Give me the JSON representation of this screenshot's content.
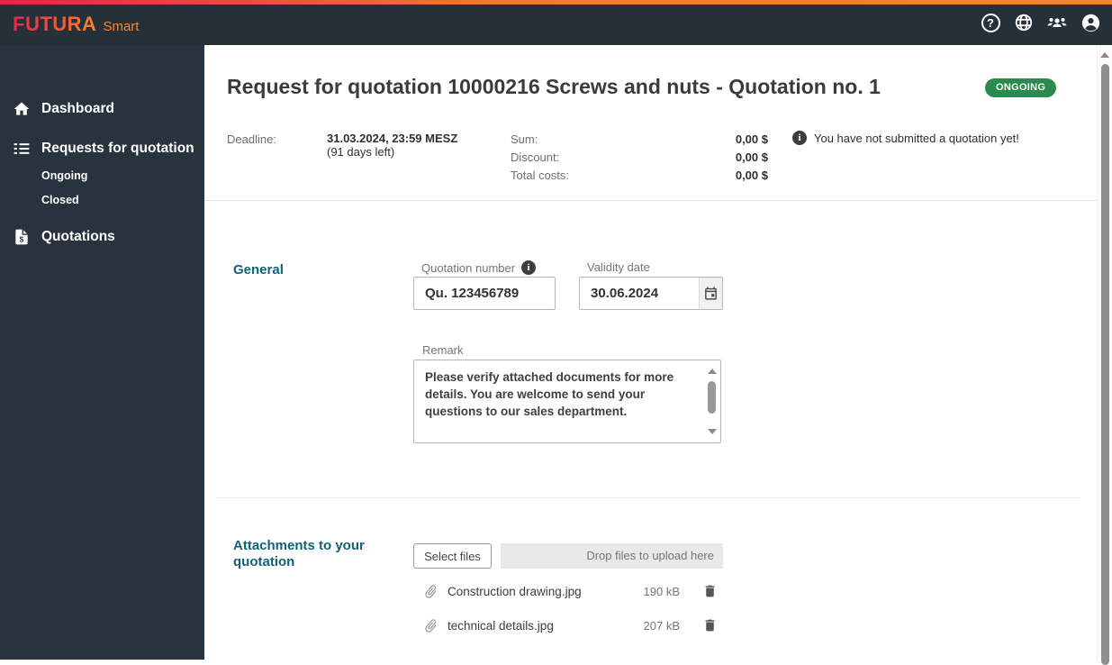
{
  "header": {
    "brand": "FUTURA",
    "brand_suffix": "Smart",
    "help_glyph": "?"
  },
  "sidebar": {
    "items": [
      {
        "label": "Dashboard"
      },
      {
        "label": "Requests for quotation"
      },
      {
        "label": "Ongoing"
      },
      {
        "label": "Closed"
      },
      {
        "label": "Quotations"
      }
    ],
    "quotations_icon_glyph": "$"
  },
  "main": {
    "title": "Request for quotation 10000216 Screws and nuts - Quotation no. 1",
    "status_badge": "ONGOING",
    "summary": {
      "deadline_label": "Deadline:",
      "deadline_value": "31.03.2024, 23:59 MESZ",
      "deadline_note": "(91 days left)",
      "rows": [
        {
          "label": "Sum:",
          "value": "0,00 $"
        },
        {
          "label": "Discount:",
          "value": "0,00 $"
        },
        {
          "label": "Total costs:",
          "value": "0,00 $"
        }
      ],
      "info_icon_glyph": "i",
      "info_message": "You have not submitted a quotation yet!"
    },
    "general": {
      "heading": "General",
      "quotation_number_label": "Quotation number",
      "quotation_number_info_glyph": "i",
      "quotation_number_value": "Qu. 123456789",
      "validity_date_label": "Validity date",
      "validity_date_value": "30.06.2024",
      "remark_label": "Remark",
      "remark_value": "Please verify attached documents for more details. You are welcome to send your questions to our sales department."
    },
    "attachments": {
      "heading": "Attachments to your quotation",
      "select_files_label": "Select files",
      "dropzone_label": "Drop files to upload here",
      "files": [
        {
          "name": "Construction drawing.jpg",
          "size": "190 kB"
        },
        {
          "name": "technical details.jpg",
          "size": "207 kB"
        }
      ]
    }
  },
  "colors": {
    "accent_teal": "#106278",
    "badge_green": "#2b8a4d",
    "gradient_start": "#e72349",
    "gradient_end": "#f08233",
    "sidebar_bg": "#28333e",
    "header_bg": "#263039"
  }
}
